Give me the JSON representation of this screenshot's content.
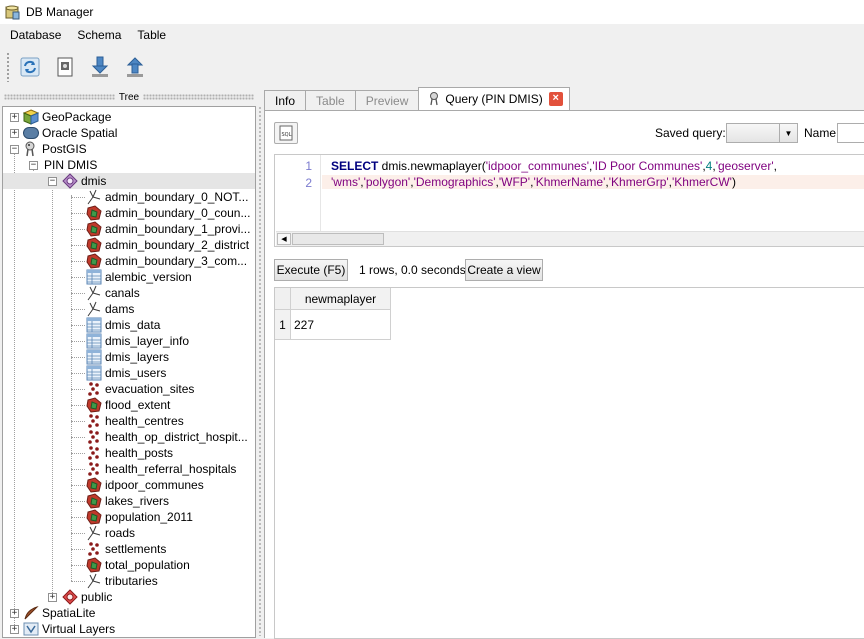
{
  "window": {
    "title": "DB Manager"
  },
  "menu": [
    "Database",
    "Schema",
    "Table"
  ],
  "toolbar": {
    "buttons": [
      {
        "name": "refresh-icon"
      },
      {
        "name": "sql-window-icon"
      },
      {
        "name": "import-layer-icon"
      },
      {
        "name": "export-layer-icon"
      }
    ]
  },
  "tree": {
    "title": "Tree",
    "providers": [
      "GeoPackage",
      "Oracle Spatial",
      "PostGIS"
    ],
    "connection": "PIN DMIS",
    "schema": "dmis",
    "tables": [
      {
        "label": "admin_boundary_0_NOT...",
        "icon": "line-layer-icon"
      },
      {
        "label": "admin_boundary_0_coun...",
        "icon": "polygon-layer-icon"
      },
      {
        "label": "admin_boundary_1_provi...",
        "icon": "polygon-layer-icon"
      },
      {
        "label": "admin_boundary_2_district",
        "icon": "polygon-layer-icon"
      },
      {
        "label": "admin_boundary_3_com...",
        "icon": "polygon-layer-icon"
      },
      {
        "label": "alembic_version",
        "icon": "table-icon"
      },
      {
        "label": "canals",
        "icon": "line-layer-icon"
      },
      {
        "label": "dams",
        "icon": "line-layer-icon"
      },
      {
        "label": "dmis_data",
        "icon": "table-icon"
      },
      {
        "label": "dmis_layer_info",
        "icon": "table-icon"
      },
      {
        "label": "dmis_layers",
        "icon": "table-icon"
      },
      {
        "label": "dmis_users",
        "icon": "table-icon"
      },
      {
        "label": "evacuation_sites",
        "icon": "point-layer-icon"
      },
      {
        "label": "flood_extent",
        "icon": "polygon-layer-icon"
      },
      {
        "label": "health_centres",
        "icon": "point-layer-icon"
      },
      {
        "label": "health_op_district_hospit...",
        "icon": "point-layer-icon"
      },
      {
        "label": "health_posts",
        "icon": "point-layer-icon"
      },
      {
        "label": "health_referral_hospitals",
        "icon": "point-layer-icon"
      },
      {
        "label": "idpoor_communes",
        "icon": "polygon-layer-icon"
      },
      {
        "label": "lakes_rivers",
        "icon": "polygon-layer-icon"
      },
      {
        "label": "population_2011",
        "icon": "polygon-layer-icon"
      },
      {
        "label": "roads",
        "icon": "line-layer-icon"
      },
      {
        "label": "settlements",
        "icon": "point-layer-icon"
      },
      {
        "label": "total_population",
        "icon": "polygon-layer-icon"
      },
      {
        "label": "tributaries",
        "icon": "line-layer-icon"
      }
    ],
    "other_schema": "public",
    "more_providers": [
      "SpatiaLite",
      "Virtual Layers"
    ]
  },
  "tabs": [
    {
      "label": "Info",
      "state": "normal"
    },
    {
      "label": "Table",
      "state": "disabled"
    },
    {
      "label": "Preview",
      "state": "disabled"
    },
    {
      "label": "Query (PIN DMIS)",
      "state": "active"
    }
  ],
  "query": {
    "saved_query_label": "Saved query:",
    "saved_query_value": "",
    "name_label": "Name",
    "name_value": "",
    "line_numbers": [
      "1",
      "2"
    ],
    "line1": {
      "keyword": "SELECT",
      "func": " dmis.newmaplayer(",
      "s1": "'idpoor_communes'",
      "s2": "'ID Poor Communes'",
      "n1": "4",
      "s3": "'geoserver'"
    },
    "line2": {
      "s1": "'wms'",
      "s2": "'polygon'",
      "s3": "'Demographics'",
      "s4": "'WFP'",
      "s5": "'KhmerName'",
      "s6": "'KhmerGrp'",
      "s7": "'KhmerCW'",
      "tail": ")"
    },
    "execute_label": "Execute (F5)",
    "rows_info": "1 rows, 0.0 seconds",
    "create_layer_label": "Create a view"
  },
  "results": {
    "columns": [
      "newmaplayer"
    ],
    "row_headers": [
      "1"
    ],
    "rows": [
      [
        "227"
      ]
    ]
  }
}
